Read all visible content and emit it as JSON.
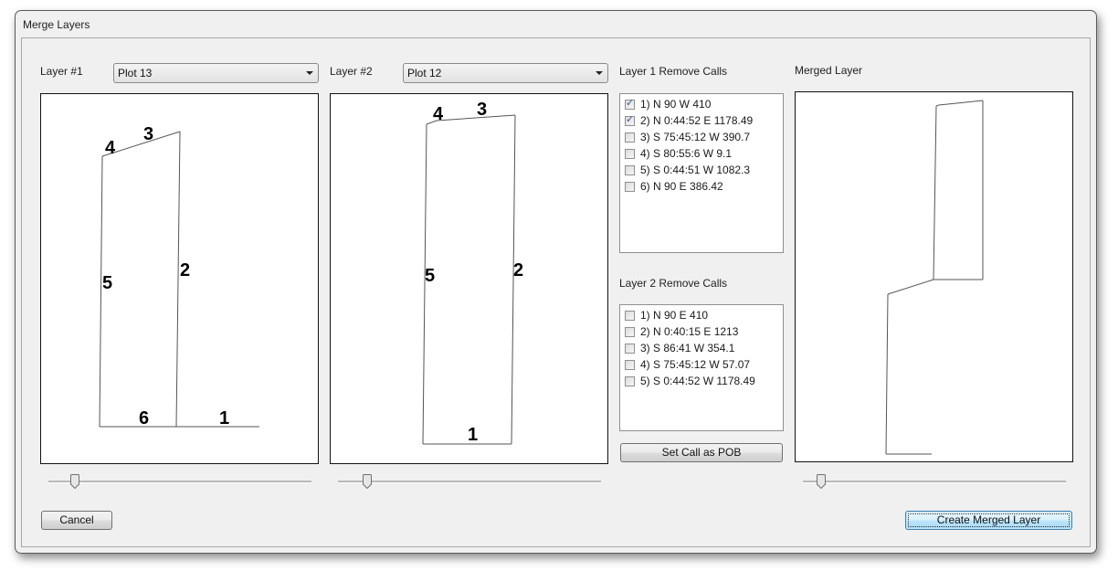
{
  "window": {
    "title": "Merge Layers"
  },
  "layer1": {
    "label": "Layer #1",
    "selected": "Plot 13",
    "slider_value_pct": 10,
    "segment_labels": [
      "1",
      "2",
      "3",
      "4",
      "5",
      "6"
    ]
  },
  "layer2": {
    "label": "Layer #2",
    "selected": "Plot 12",
    "slider_value_pct": 11,
    "segment_labels": [
      "1",
      "2",
      "3",
      "4",
      "5"
    ]
  },
  "remove1": {
    "label": "Layer 1 Remove Calls",
    "items": [
      {
        "text": "1) N 90 W 410",
        "checked": true
      },
      {
        "text": "2) N 0:44:52 E 1178.49",
        "checked": true
      },
      {
        "text": "3) S 75:45:12 W 390.7",
        "checked": false
      },
      {
        "text": "4) S 80:55:6 W 9.1",
        "checked": false
      },
      {
        "text": "5) S 0:44:51 W 1082.3",
        "checked": false
      },
      {
        "text": "6) N 90 E 386.42",
        "checked": false
      }
    ]
  },
  "remove2": {
    "label": "Layer 2 Remove Calls",
    "items": [
      {
        "text": "1) N 90 E 410",
        "checked": false
      },
      {
        "text": "2) N 0:40:15 E 1213",
        "checked": false
      },
      {
        "text": "3) S 86:41 W 354.1",
        "checked": false
      },
      {
        "text": "4) S 75:45:12 W 57.07",
        "checked": false
      },
      {
        "text": "5) S 0:44:52 W 1178.49",
        "checked": false
      }
    ]
  },
  "merged": {
    "label": "Merged Layer",
    "slider_value_pct": 7
  },
  "buttons": {
    "set_pob": "Set Call as POB",
    "cancel": "Cancel",
    "create": "Create Merged Layer"
  }
}
